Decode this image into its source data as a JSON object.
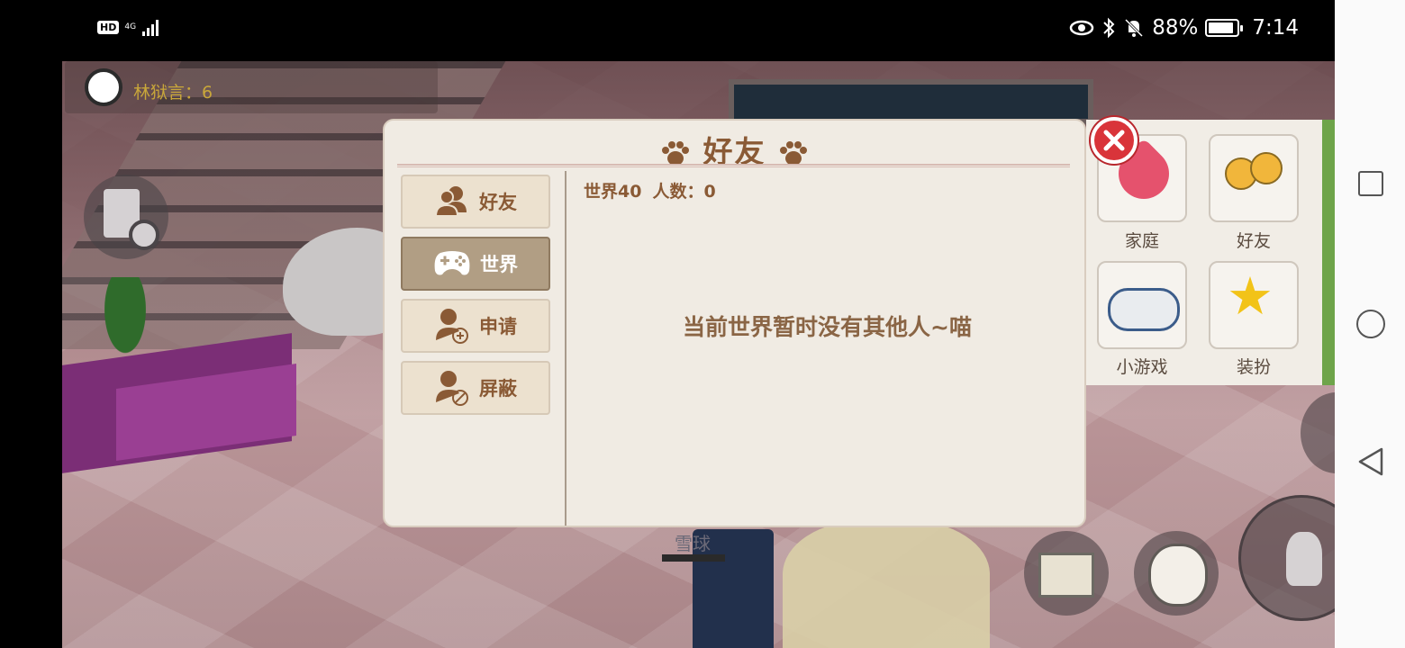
{
  "status_bar": {
    "hd": "HD",
    "network": "4G",
    "battery_text": "88%",
    "battery_level": 0.88,
    "time": "7:14"
  },
  "scene": {
    "player_label": "林狱言：6",
    "character_name": "雪球"
  },
  "side_menu": {
    "items": [
      {
        "label": "家庭",
        "icon": "heart-icon"
      },
      {
        "label": "好友",
        "icon": "friends-icon"
      },
      {
        "label": "小游戏",
        "icon": "gamepad-icon"
      },
      {
        "label": "装扮",
        "icon": "magic-wand-icon"
      }
    ]
  },
  "dialog": {
    "title": "好友",
    "tabs": [
      {
        "label": "好友",
        "icon": "friends-icon",
        "active": false
      },
      {
        "label": "世界",
        "icon": "gamepad-icon",
        "active": true
      },
      {
        "label": "申请",
        "icon": "add-person-icon",
        "active": false
      },
      {
        "label": "屏蔽",
        "icon": "block-person-icon",
        "active": false
      }
    ],
    "world_label": "世界40",
    "count_label": "人数：0",
    "empty_message": "当前世界暂时没有其他人~喵"
  },
  "colors": {
    "dialog_bg": "#f0ebe3",
    "accent_brown": "#8a5a35",
    "active_tab": "#b19e84",
    "close_red": "#d9343a"
  }
}
